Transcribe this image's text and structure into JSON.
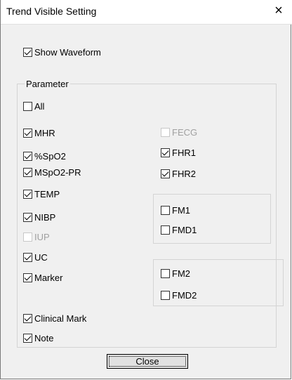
{
  "window": {
    "title": "Trend Visible Setting",
    "close_glyph": "×"
  },
  "show_waveform": {
    "label": "Show Waveform",
    "checked": true
  },
  "parameter_group": {
    "title": "Parameter"
  },
  "all": {
    "label": "All",
    "checked": false
  },
  "left_items": [
    {
      "label": "MHR",
      "checked": true,
      "enabled": true
    },
    {
      "label": "%SpO2",
      "checked": true,
      "enabled": true
    },
    {
      "label": "MSpO2-PR",
      "checked": true,
      "enabled": true
    },
    {
      "label": "TEMP",
      "checked": true,
      "enabled": true
    },
    {
      "label": "NIBP",
      "checked": true,
      "enabled": true
    },
    {
      "label": "IUP",
      "checked": false,
      "enabled": false
    },
    {
      "label": "UC",
      "checked": true,
      "enabled": true
    },
    {
      "label": "Marker",
      "checked": true,
      "enabled": true
    }
  ],
  "right_items": [
    {
      "label": "FECG",
      "checked": false,
      "enabled": false
    },
    {
      "label": "FHR1",
      "checked": true,
      "enabled": true
    },
    {
      "label": "FHR2",
      "checked": true,
      "enabled": true
    }
  ],
  "fm_group_1": [
    {
      "label": "FM1",
      "checked": false
    },
    {
      "label": "FMD1",
      "checked": false
    }
  ],
  "fm_group_2": [
    {
      "label": "FM2",
      "checked": false
    },
    {
      "label": "FMD2",
      "checked": false
    }
  ],
  "bottom_items": [
    {
      "label": "Clinical Mark",
      "checked": true
    },
    {
      "label": "Note",
      "checked": true
    }
  ],
  "close_button": {
    "label": "Close"
  }
}
